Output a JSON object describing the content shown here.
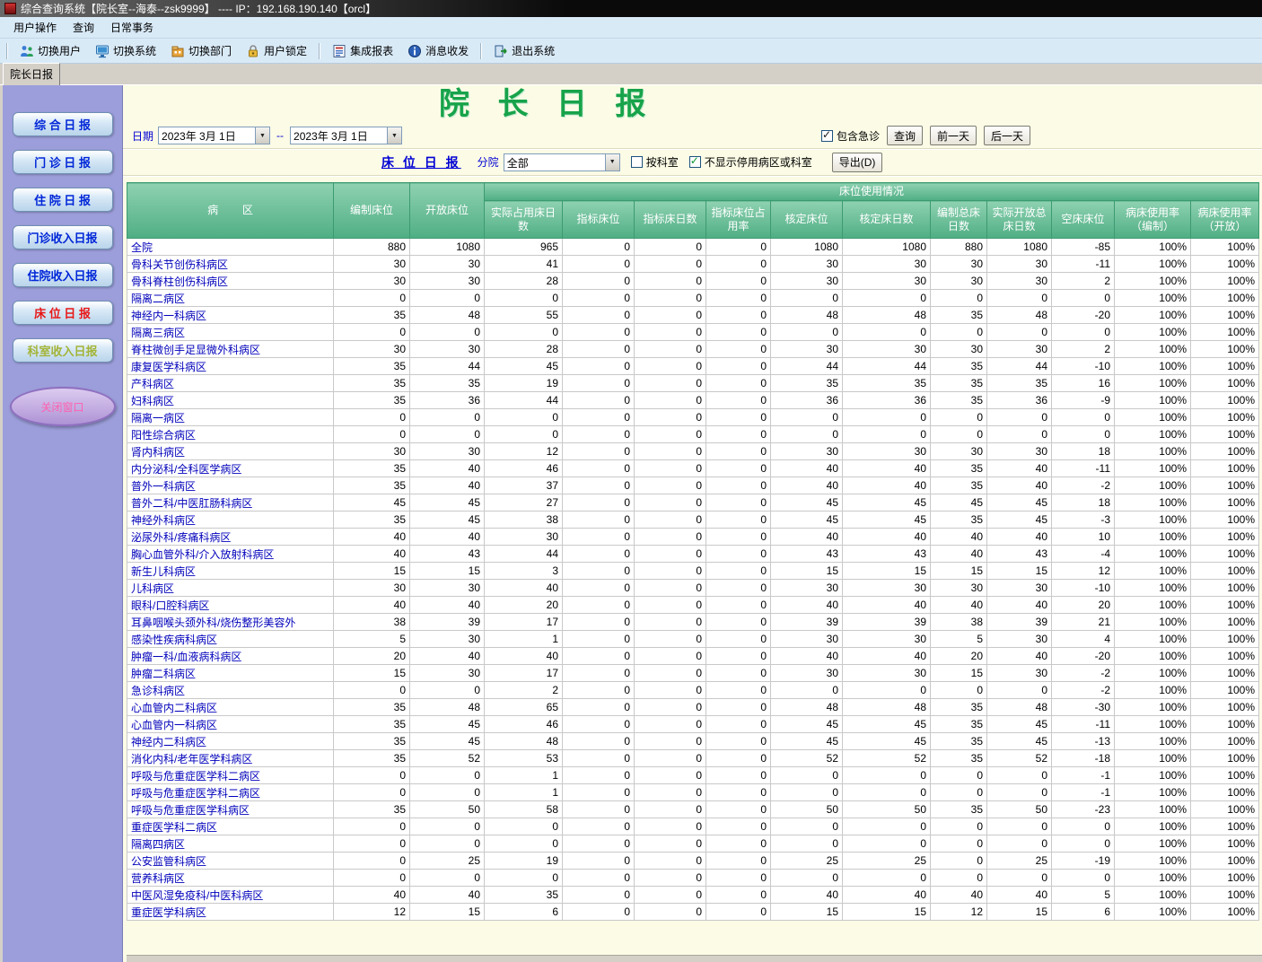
{
  "colors": {
    "table_header_green": "#55b189",
    "report_title_green": "#17a34a",
    "active_sidebar_red": "#e81717",
    "sidebar_bg": "#9c9edb",
    "link_blue": "#0000d4"
  },
  "titlebar": {
    "title": "综合查询系统【院长室--海泰--zsk9999】 ---- IP：192.168.190.140【orcl】"
  },
  "menubar": {
    "items": [
      "用户操作",
      "查询",
      "日常事务"
    ]
  },
  "toolbar": {
    "items": [
      "切换用户",
      "切换系统",
      "切换部门",
      "用户锁定",
      "集成报表",
      "消息收发",
      "退出系统"
    ]
  },
  "tabs": {
    "active": "院长日报"
  },
  "sidebar": {
    "buttons": [
      "综 合 日 报",
      "门 诊 日 报",
      "住 院 日 报",
      "门诊收入日报",
      "住院收入日报",
      "床 位 日 报",
      "科室收入日报"
    ],
    "oval": "关闭窗口"
  },
  "report": {
    "title": "院 长 日 报"
  },
  "filters": {
    "date_label": "日期",
    "date_from": "2023年 3月 1日",
    "date_sep": "--",
    "date_to": "2023年 3月 1日",
    "include_emergency": "包含急诊",
    "query": "查询",
    "prev_day": "前一天",
    "next_day": "后一天",
    "subtitle": "床 位 日 报",
    "branch_label": "分院",
    "branch_value": "全部",
    "by_dept": "按科室",
    "hide_disabled": "不显示停用病区或科室",
    "export": "导出(D)"
  },
  "table": {
    "ward_header": "病        区",
    "group_header": "床位使用情况",
    "cols": [
      "编制床位",
      "开放床位",
      "实际占用床日数",
      "指标床位",
      "指标床日数",
      "指标床位占用率",
      "核定床位",
      "核定床日数",
      "编制总床日数",
      "实际开放总床日数",
      "空床床位",
      "病床使用率（编制）",
      "病床使用率（开放）"
    ],
    "rows": [
      [
        "全院",
        880,
        1080,
        965,
        0,
        0,
        0,
        1080,
        1080,
        880,
        1080,
        -85,
        "100%",
        "100%"
      ],
      [
        "骨科关节创伤科病区",
        30,
        30,
        41,
        0,
        0,
        0,
        30,
        30,
        30,
        30,
        -11,
        "100%",
        "100%"
      ],
      [
        "骨科脊柱创伤科病区",
        30,
        30,
        28,
        0,
        0,
        0,
        30,
        30,
        30,
        30,
        2,
        "100%",
        "100%"
      ],
      [
        "隔离二病区",
        0,
        0,
        0,
        0,
        0,
        0,
        0,
        0,
        0,
        0,
        0,
        "100%",
        "100%"
      ],
      [
        "神经内一科病区",
        35,
        48,
        55,
        0,
        0,
        0,
        48,
        48,
        35,
        48,
        -20,
        "100%",
        "100%"
      ],
      [
        "隔离三病区",
        0,
        0,
        0,
        0,
        0,
        0,
        0,
        0,
        0,
        0,
        0,
        "100%",
        "100%"
      ],
      [
        "脊柱微创手足显微外科病区",
        30,
        30,
        28,
        0,
        0,
        0,
        30,
        30,
        30,
        30,
        2,
        "100%",
        "100%"
      ],
      [
        "康复医学科病区",
        35,
        44,
        45,
        0,
        0,
        0,
        44,
        44,
        35,
        44,
        -10,
        "100%",
        "100%"
      ],
      [
        "产科病区",
        35,
        35,
        19,
        0,
        0,
        0,
        35,
        35,
        35,
        35,
        16,
        "100%",
        "100%"
      ],
      [
        "妇科病区",
        35,
        36,
        44,
        0,
        0,
        0,
        36,
        36,
        35,
        36,
        -9,
        "100%",
        "100%"
      ],
      [
        "隔离一病区",
        0,
        0,
        0,
        0,
        0,
        0,
        0,
        0,
        0,
        0,
        0,
        "100%",
        "100%"
      ],
      [
        "阳性综合病区",
        0,
        0,
        0,
        0,
        0,
        0,
        0,
        0,
        0,
        0,
        0,
        "100%",
        "100%"
      ],
      [
        "肾内科病区",
        30,
        30,
        12,
        0,
        0,
        0,
        30,
        30,
        30,
        30,
        18,
        "100%",
        "100%"
      ],
      [
        "内分泌科/全科医学病区",
        35,
        40,
        46,
        0,
        0,
        0,
        40,
        40,
        35,
        40,
        -11,
        "100%",
        "100%"
      ],
      [
        "普外一科病区",
        35,
        40,
        37,
        0,
        0,
        0,
        40,
        40,
        35,
        40,
        -2,
        "100%",
        "100%"
      ],
      [
        "普外二科/中医肛肠科病区",
        45,
        45,
        27,
        0,
        0,
        0,
        45,
        45,
        45,
        45,
        18,
        "100%",
        "100%"
      ],
      [
        "神经外科病区",
        35,
        45,
        38,
        0,
        0,
        0,
        45,
        45,
        35,
        45,
        -3,
        "100%",
        "100%"
      ],
      [
        "泌尿外科/疼痛科病区",
        40,
        40,
        30,
        0,
        0,
        0,
        40,
        40,
        40,
        40,
        10,
        "100%",
        "100%"
      ],
      [
        "胸心血管外科/介入放射科病区",
        40,
        43,
        44,
        0,
        0,
        0,
        43,
        43,
        40,
        43,
        -4,
        "100%",
        "100%"
      ],
      [
        "新生儿科病区",
        15,
        15,
        3,
        0,
        0,
        0,
        15,
        15,
        15,
        15,
        12,
        "100%",
        "100%"
      ],
      [
        "儿科病区",
        30,
        30,
        40,
        0,
        0,
        0,
        30,
        30,
        30,
        30,
        -10,
        "100%",
        "100%"
      ],
      [
        "眼科/口腔科病区",
        40,
        40,
        20,
        0,
        0,
        0,
        40,
        40,
        40,
        40,
        20,
        "100%",
        "100%"
      ],
      [
        "耳鼻咽喉头颈外科/烧伤整形美容外",
        38,
        39,
        17,
        0,
        0,
        0,
        39,
        39,
        38,
        39,
        21,
        "100%",
        "100%"
      ],
      [
        "感染性疾病科病区",
        5,
        30,
        1,
        0,
        0,
        0,
        30,
        30,
        5,
        30,
        4,
        "100%",
        "100%"
      ],
      [
        "肿瘤一科/血液病科病区",
        20,
        40,
        40,
        0,
        0,
        0,
        40,
        40,
        20,
        40,
        -20,
        "100%",
        "100%"
      ],
      [
        "肿瘤二科病区",
        15,
        30,
        17,
        0,
        0,
        0,
        30,
        30,
        15,
        30,
        -2,
        "100%",
        "100%"
      ],
      [
        "急诊科病区",
        0,
        0,
        2,
        0,
        0,
        0,
        0,
        0,
        0,
        0,
        -2,
        "100%",
        "100%"
      ],
      [
        "心血管内二科病区",
        35,
        48,
        65,
        0,
        0,
        0,
        48,
        48,
        35,
        48,
        -30,
        "100%",
        "100%"
      ],
      [
        "心血管内一科病区",
        35,
        45,
        46,
        0,
        0,
        0,
        45,
        45,
        35,
        45,
        -11,
        "100%",
        "100%"
      ],
      [
        "神经内二科病区",
        35,
        45,
        48,
        0,
        0,
        0,
        45,
        45,
        35,
        45,
        -13,
        "100%",
        "100%"
      ],
      [
        "消化内科/老年医学科病区",
        35,
        52,
        53,
        0,
        0,
        0,
        52,
        52,
        35,
        52,
        -18,
        "100%",
        "100%"
      ],
      [
        "呼吸与危重症医学科二病区",
        0,
        0,
        1,
        0,
        0,
        0,
        0,
        0,
        0,
        0,
        -1,
        "100%",
        "100%"
      ],
      [
        "呼吸与危重症医学科二病区",
        0,
        0,
        1,
        0,
        0,
        0,
        0,
        0,
        0,
        0,
        -1,
        "100%",
        "100%"
      ],
      [
        "呼吸与危重症医学科病区",
        35,
        50,
        58,
        0,
        0,
        0,
        50,
        50,
        35,
        50,
        -23,
        "100%",
        "100%"
      ],
      [
        "重症医学科二病区",
        0,
        0,
        0,
        0,
        0,
        0,
        0,
        0,
        0,
        0,
        0,
        "100%",
        "100%"
      ],
      [
        "隔离四病区",
        0,
        0,
        0,
        0,
        0,
        0,
        0,
        0,
        0,
        0,
        0,
        "100%",
        "100%"
      ],
      [
        "公安监管科病区",
        0,
        25,
        19,
        0,
        0,
        0,
        25,
        25,
        0,
        25,
        -19,
        "100%",
        "100%"
      ],
      [
        "营养科病区",
        0,
        0,
        0,
        0,
        0,
        0,
        0,
        0,
        0,
        0,
        0,
        "100%",
        "100%"
      ],
      [
        "中医风湿免疫科/中医科病区",
        40,
        40,
        35,
        0,
        0,
        0,
        40,
        40,
        40,
        40,
        5,
        "100%",
        "100%"
      ],
      [
        "重症医学科病区",
        12,
        15,
        6,
        0,
        0,
        0,
        15,
        15,
        12,
        15,
        6,
        "100%",
        "100%"
      ]
    ]
  }
}
